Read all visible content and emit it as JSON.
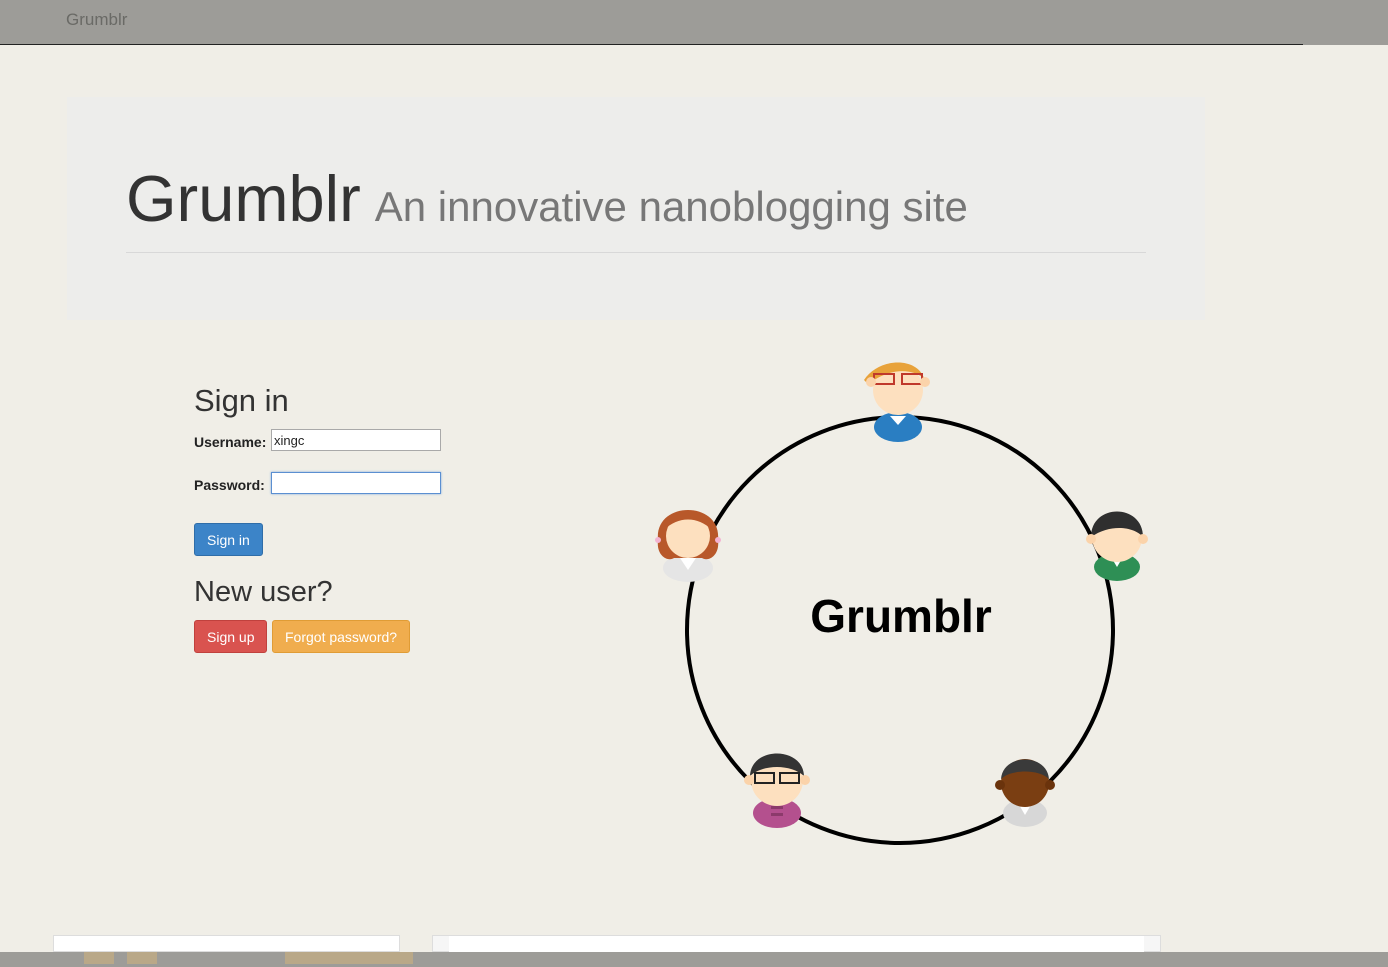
{
  "navbar": {
    "brand": "Grumblr"
  },
  "jumbotron": {
    "title": "Grumblr",
    "subtitle": "An innovative nanoblogging site"
  },
  "signin": {
    "heading": "Sign in",
    "username_label": "Username:",
    "username_value": "xingc",
    "password_label": "Password:",
    "password_value": "",
    "submit_label": "Sign in"
  },
  "newuser": {
    "heading": "New user?",
    "signup_label": "Sign up",
    "forgot_label": "Forgot password?"
  },
  "logo": {
    "text": "Grumblr",
    "avatars": [
      "person-glasses-blue-icon",
      "person-green-icon",
      "person-dark-skin-icon",
      "person-glasses-pink-icon",
      "person-redhead-icon"
    ]
  },
  "colors": {
    "background": "#f0eee7",
    "navbar": "#9d9c98",
    "jumbotron": "#ededeb",
    "primary": "#3c84c8",
    "danger": "#d9534f",
    "warning": "#f0ad4e"
  }
}
